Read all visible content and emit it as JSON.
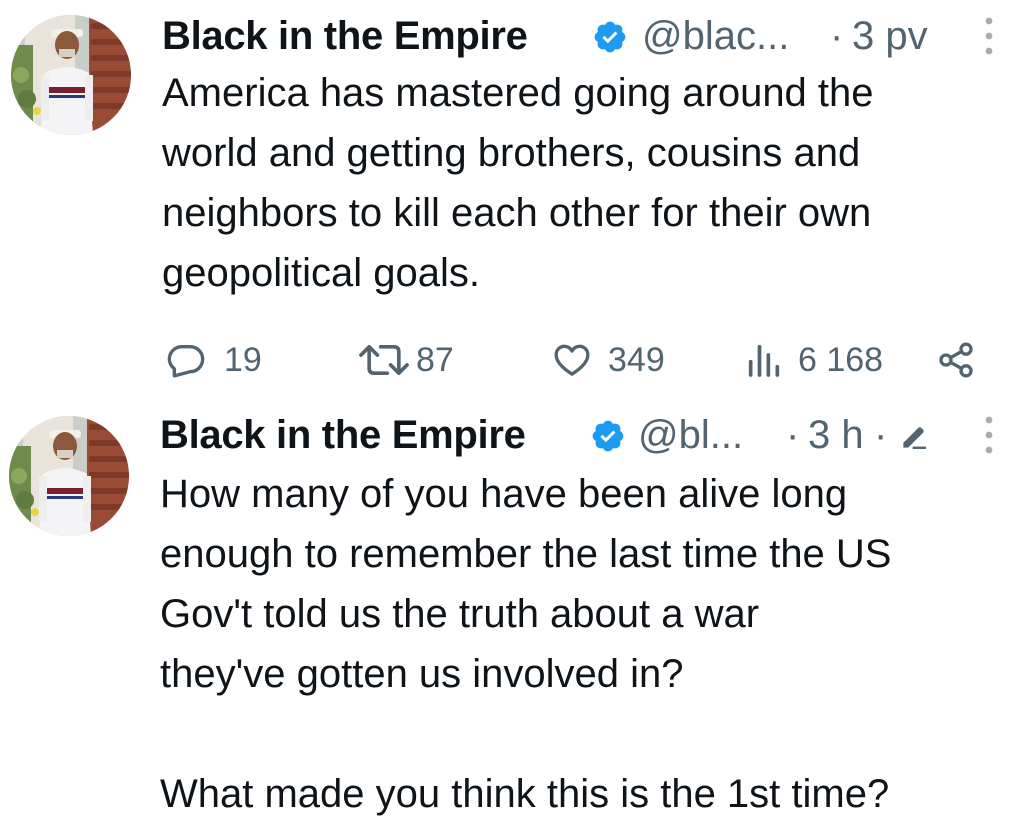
{
  "tweets": [
    {
      "author": {
        "display_name": "Black in the Empire",
        "handle": "@blac...",
        "verified": true,
        "avatar_icon": "avatar-photo"
      },
      "separator": "·",
      "timestamp": "3 pv",
      "text": "America has mastered going around the\nworld and getting brothers, cousins and\nneighbors to kill each other for their own\ngeopolitical goals.",
      "actions": {
        "replies": "19",
        "reposts": "87",
        "likes": "349",
        "views": "6 168"
      }
    },
    {
      "author": {
        "display_name": "Black in the Empire",
        "handle": "@bl...",
        "verified": true,
        "avatar_icon": "avatar-photo"
      },
      "separator": "·",
      "timestamp": "3 h",
      "separator_2": "·",
      "edited": true,
      "text": "How many of you have been alive long\nenough to remember the last time the US\nGov't told us the truth about a war\nthey've gotten us involved in?\n\nWhat made you think this is the 1st time?"
    }
  ],
  "icons": {
    "verified": "verified-badge-icon",
    "more": "more-options-icon",
    "reply": "reply-icon",
    "repost": "repost-icon",
    "like": "like-icon",
    "views": "views-icon",
    "share": "share-icon",
    "edited": "edited-pencil-icon"
  },
  "colors": {
    "text_primary": "#0f1419",
    "text_secondary": "#536471",
    "verified_blue": "#1d9bf0",
    "background": "#ffffff"
  }
}
